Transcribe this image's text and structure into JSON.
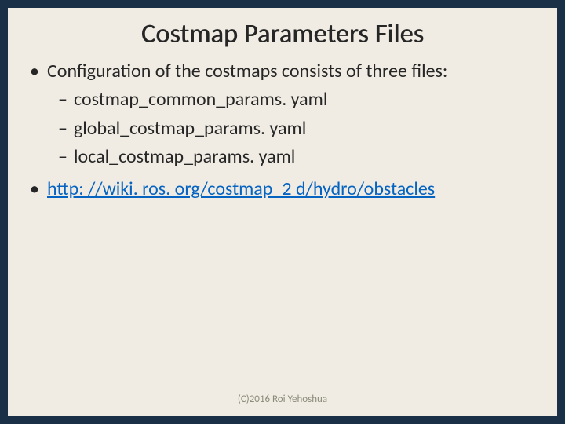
{
  "slide": {
    "title": "Costmap Parameters Files",
    "bullets": [
      {
        "text": "Configuration of the costmaps consists of three files:",
        "sub": [
          "costmap_common_params. yaml",
          "global_costmap_params. yaml",
          "local_costmap_params. yaml"
        ]
      },
      {
        "link_text": "http: //wiki. ros. org/costmap_2 d/hydro/obstacles"
      }
    ],
    "footer": "(C)2016 Roi Yehoshua"
  },
  "glyphs": {
    "bullet_l1": "•",
    "bullet_l2": "–"
  }
}
